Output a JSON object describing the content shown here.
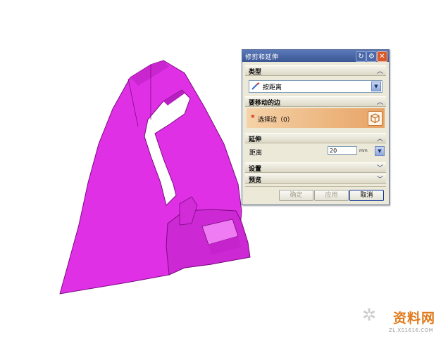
{
  "dialog": {
    "title": "修剪和延伸",
    "groups": {
      "type": {
        "header": "类型",
        "value": "按距离"
      },
      "edges": {
        "header": "要移动的边",
        "select_label": "选择边（0）"
      },
      "extend": {
        "header": "延伸",
        "distance_label": "距离",
        "distance_value": "20",
        "unit": "mm"
      },
      "settings": {
        "header": "设置"
      },
      "preview": {
        "header": "预览"
      }
    },
    "buttons": {
      "ok": "确定",
      "apply": "应用",
      "cancel": "取消"
    }
  },
  "watermark": {
    "main": "资料网",
    "url": "ZL.XS1616.COM"
  },
  "colors": {
    "part_surface": "#e030e6",
    "part_shadow": "#b81fc1",
    "titlebar": "#3f5c9c",
    "selection_row": "#eeb37c",
    "dialog_bg": "#ece9d8"
  }
}
